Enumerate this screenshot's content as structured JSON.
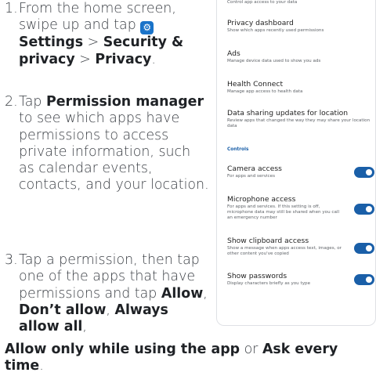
{
  "instructions": {
    "step1": {
      "num": "1.",
      "prefix": "From the home screen, swipe up and tap",
      "icon": "settings-icon",
      "settings": "Settings",
      "sep1": ">",
      "security": "Security & privacy",
      "sep2": ">",
      "privacy": "Privacy",
      "end": "."
    },
    "step2": {
      "num": "2.",
      "prefix": "Tap",
      "permission_manager": "Permission manager",
      "rest": "to see which apps have permissions to access private information, such as calendar events, contacts, and your location."
    },
    "step3": {
      "num": "3.",
      "prefix": "Tap a permission, then tap one of the apps that have permissions and tap",
      "allow": "Allow",
      "comma1": ",",
      "dont_allow": "Don’t allow",
      "comma2": ",",
      "always_allow_all": "Always allow all",
      "comma3": ",",
      "allow_while_using": "Allow only while using the app",
      "or": "or",
      "ask_every_time": "Ask every time",
      "end": "."
    }
  },
  "phone": {
    "top_subtitle": "Control app access to your data",
    "items": [
      {
        "title": "Privacy dashboard",
        "subtitle": "Show which apps recently used permissions"
      },
      {
        "title": "Ads",
        "subtitle": "Manage device data used to show you ads"
      },
      {
        "title": "Health Connect",
        "subtitle": "Manage app access to health data"
      },
      {
        "title": "Data sharing updates for location",
        "subtitle": "Review apps that changed the way they may share your location data"
      }
    ],
    "section_label": "Controls",
    "controls": [
      {
        "title": "Camera access",
        "subtitle": "For apps and services",
        "on": true
      },
      {
        "title": "Microphone access",
        "subtitle": "For apps and services. If this setting is off, microphone data may still be shared when you call an emergency number",
        "on": true
      },
      {
        "title": "Show clipboard access",
        "subtitle": "Show a message when apps access text, images, or other content you've copied",
        "on": true
      },
      {
        "title": "Show passwords",
        "subtitle": "Display characters briefly as you type",
        "on": true
      }
    ],
    "accent": "#1a5fa8",
    "settings_icon_color": "#1a73c9"
  }
}
